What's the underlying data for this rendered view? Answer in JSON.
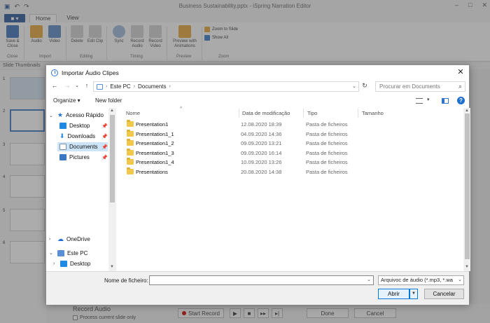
{
  "app": {
    "title": "Business Sustainability.pptx - iSpring Narration Editor",
    "file_tab": "■ ▾",
    "tabs": [
      "Home",
      "View"
    ],
    "ribbon": {
      "save_close": "Save & Close",
      "audio": "Audio",
      "video": "Video",
      "delete": "Delete",
      "edit_clip": "Edit Clip",
      "sync": "Sync",
      "record_audio": "Record Audio",
      "record_video": "Record Video",
      "preview": "Preview with Animations",
      "zoom_slide": "Zoom to Slide",
      "show_all": "Show All",
      "groups": [
        "Close",
        "Import",
        "Editing",
        "Timing",
        "Preview",
        "Zoom"
      ]
    },
    "pane_title": "Slide Thumbnails",
    "slide_numbers": [
      "1",
      "2",
      "3",
      "4",
      "5",
      "6"
    ],
    "record_audio_label": "Record Audio",
    "process_label": "Process current slide only",
    "start_record": "Start Record",
    "done": "Done",
    "cancel": "Cancel"
  },
  "dialog": {
    "title": "Importar Áudio Clipes",
    "close_glyph": "✕",
    "path": [
      "Este PC",
      "Documents"
    ],
    "search_placeholder": "Procurar em Documents",
    "organize": "Organize ▾",
    "new_folder": "New folder",
    "help_glyph": "?",
    "nav": {
      "quick_access": "Acesso Rápido",
      "items": [
        {
          "label": "Desktop",
          "icon": "desktop-icon",
          "color": "#1e88e5"
        },
        {
          "label": "Downloads",
          "icon": "download-icon",
          "color": "#1e88e5"
        },
        {
          "label": "Documents",
          "icon": "document-icon",
          "color": "#7b8da3"
        },
        {
          "label": "Pictures",
          "icon": "pictures-icon",
          "color": "#3a78c7"
        }
      ],
      "onedrive": "OneDrive",
      "this_pc": "Este PC",
      "pc_desktop": "Desktop"
    },
    "columns": {
      "name": "Nome",
      "date": "Data de modificação",
      "type": "Tipo",
      "size": "Tamanho"
    },
    "files": [
      {
        "name": "Presentation1",
        "date": "12.08.2020 18:39",
        "type": "Pasta de ficheiros"
      },
      {
        "name": "Presentation1_1",
        "date": "04.09.2020 14:36",
        "type": "Pasta de ficheiros"
      },
      {
        "name": "Presentation1_2",
        "date": "09.09.2020 13:21",
        "type": "Pasta de ficheiros"
      },
      {
        "name": "Presentation1_3",
        "date": "09.09.2020 16:14",
        "type": "Pasta de ficheiros"
      },
      {
        "name": "Presentation1_4",
        "date": "10.09.2020 13:26",
        "type": "Pasta de ficheiros"
      },
      {
        "name": "Presentations",
        "date": "20.08.2020 14:38",
        "type": "Pasta de ficheiros"
      }
    ],
    "filename_label": "Nome de ficheiro:",
    "filename_value": "",
    "filetype": "Arquivoc de áudio (*.mp3, *.wa",
    "open": "Abrir",
    "cancel": "Cancelar"
  }
}
